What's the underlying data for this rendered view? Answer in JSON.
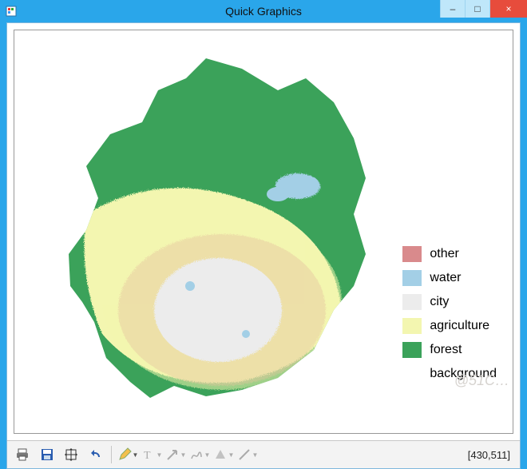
{
  "window": {
    "title": "Quick Graphics",
    "controls": {
      "minimize": "–",
      "maximize": "□",
      "close": "×"
    }
  },
  "legend": {
    "items": [
      {
        "key": "other",
        "label": "other",
        "color": "#d98a8c"
      },
      {
        "key": "water",
        "label": "water",
        "color": "#a3cfe6"
      },
      {
        "key": "city",
        "label": "city",
        "color": "#ececec"
      },
      {
        "key": "agriculture",
        "label": "agriculture",
        "color": "#f3f6b0"
      },
      {
        "key": "forest",
        "label": "forest",
        "color": "#3ba25a"
      },
      {
        "key": "background",
        "label": "background",
        "color": "#ffffff"
      }
    ]
  },
  "map": {
    "classification_colors": {
      "other": "#d98a8c",
      "water": "#a3cfe6",
      "city": "#ececec",
      "agriculture": "#f3f6b0",
      "forest": "#3ba25a",
      "background": "#ffffff"
    },
    "approx_regions": [
      {
        "class": "forest",
        "area_fraction": 0.55,
        "location": "north and west mountains"
      },
      {
        "class": "agriculture",
        "area_fraction": 0.22,
        "location": "transition belt around urban core and southeast plain"
      },
      {
        "class": "city",
        "area_fraction": 0.1,
        "location": "central-south urban core"
      },
      {
        "class": "other",
        "area_fraction": 0.09,
        "location": "scattered patches within agriculture/city zones"
      },
      {
        "class": "water",
        "area_fraction": 0.04,
        "location": "northeast reservoir plus small ponds"
      }
    ]
  },
  "toolbar": {
    "buttons": [
      {
        "key": "print",
        "name": "print-icon",
        "enabled": true
      },
      {
        "key": "save",
        "name": "save-icon",
        "enabled": true
      },
      {
        "key": "fit",
        "name": "fit-extent-icon",
        "enabled": true
      },
      {
        "key": "undo",
        "name": "undo-icon",
        "enabled": true
      },
      {
        "key": "sep1",
        "separator": true
      },
      {
        "key": "edit",
        "name": "pencil-icon",
        "enabled": true,
        "dropdown": true
      },
      {
        "key": "text",
        "name": "text-tool-icon",
        "enabled": false,
        "dropdown": true
      },
      {
        "key": "arrow",
        "name": "arrow-tool-icon",
        "enabled": false,
        "dropdown": true
      },
      {
        "key": "freehand",
        "name": "freehand-tool-icon",
        "enabled": false,
        "dropdown": true
      },
      {
        "key": "shape",
        "name": "shape-tool-icon",
        "enabled": false,
        "dropdown": true
      },
      {
        "key": "line",
        "name": "line-tool-icon",
        "enabled": false,
        "dropdown": true
      }
    ]
  },
  "status": {
    "coords": "[430,511]"
  },
  "watermark": "@51C…"
}
